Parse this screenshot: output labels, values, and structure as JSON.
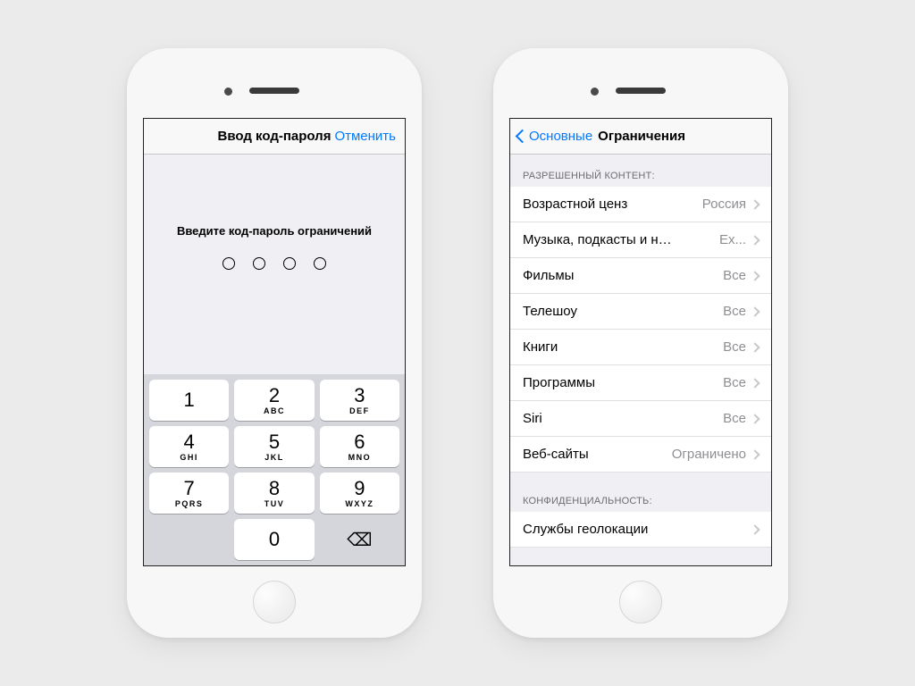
{
  "left": {
    "nav_title": "Ввод код-пароля",
    "cancel": "Отменить",
    "prompt": "Введите код-пароль ограничений",
    "keypad": [
      {
        "num": "1",
        "let": ""
      },
      {
        "num": "2",
        "let": "ABC"
      },
      {
        "num": "3",
        "let": "DEF"
      },
      {
        "num": "4",
        "let": "GHI"
      },
      {
        "num": "5",
        "let": "JKL"
      },
      {
        "num": "6",
        "let": "MNO"
      },
      {
        "num": "7",
        "let": "PQRS"
      },
      {
        "num": "8",
        "let": "TUV"
      },
      {
        "num": "9",
        "let": "WXYZ"
      },
      {
        "num": "0",
        "let": ""
      }
    ]
  },
  "right": {
    "back_label": "Основные",
    "title": "Ограничения",
    "section1_header": "Разрешенный контент:",
    "section2_header": "Конфиденциальность:",
    "rows": [
      {
        "label": "Возрастной ценз",
        "value": "Россия"
      },
      {
        "label": "Музыка, подкасты и новости",
        "value": "Ex..."
      },
      {
        "label": "Фильмы",
        "value": "Все"
      },
      {
        "label": "Телешоу",
        "value": "Все"
      },
      {
        "label": "Книги",
        "value": "Все"
      },
      {
        "label": "Программы",
        "value": "Все"
      },
      {
        "label": "Siri",
        "value": "Все"
      },
      {
        "label": "Веб-сайты",
        "value": "Ограничено"
      }
    ],
    "rows2": [
      {
        "label": "Службы геолокации",
        "value": ""
      }
    ]
  }
}
